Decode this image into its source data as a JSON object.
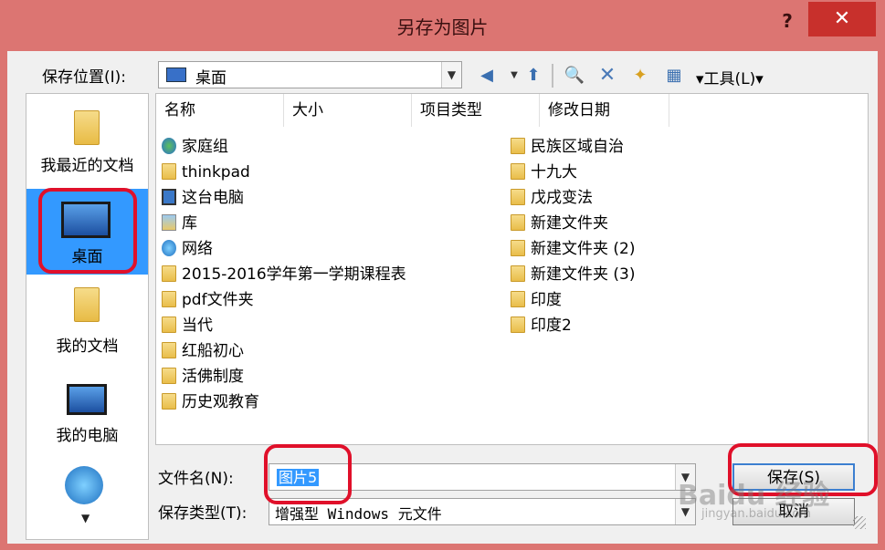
{
  "dialog": {
    "title": "另存为图片",
    "help_label": "?",
    "close_label": "✕"
  },
  "location": {
    "label": "保存位置(I):",
    "value": "桌面",
    "icon": "monitor-icon"
  },
  "toolbar": {
    "tools_label": "▾工具(L)▾"
  },
  "places": [
    {
      "label": "我最近的文档",
      "icon": "folder-icon"
    },
    {
      "label": "桌面",
      "icon": "monitor-icon",
      "selected": true
    },
    {
      "label": "我的文档",
      "icon": "folder-icon"
    },
    {
      "label": "我的电脑",
      "icon": "computer-icon"
    },
    {
      "label": "",
      "icon": "network-globe-icon"
    }
  ],
  "columns": [
    "名称",
    "大小",
    "项目类型",
    "修改日期"
  ],
  "files_left": [
    {
      "name": "家庭组",
      "icon": "homegroup-icon"
    },
    {
      "name": "thinkpad",
      "icon": "folder-icon"
    },
    {
      "name": "这台电脑",
      "icon": "computer-icon"
    },
    {
      "name": "库",
      "icon": "library-icon"
    },
    {
      "name": "网络",
      "icon": "network-icon"
    },
    {
      "name": "2015-2016学年第一学期课程表",
      "icon": "folder-icon"
    },
    {
      "name": "pdf文件夹",
      "icon": "folder-icon"
    },
    {
      "name": "当代",
      "icon": "folder-icon"
    },
    {
      "name": "红船初心",
      "icon": "folder-icon"
    },
    {
      "name": "活佛制度",
      "icon": "folder-icon"
    },
    {
      "name": "历史观教育",
      "icon": "folder-icon"
    }
  ],
  "files_right": [
    {
      "name": "民族区域自治",
      "icon": "folder-icon"
    },
    {
      "name": "十九大",
      "icon": "folder-icon"
    },
    {
      "name": "戊戌变法",
      "icon": "folder-icon"
    },
    {
      "name": "新建文件夹",
      "icon": "folder-icon"
    },
    {
      "name": "新建文件夹 (2)",
      "icon": "folder-icon"
    },
    {
      "name": "新建文件夹 (3)",
      "icon": "folder-icon"
    },
    {
      "name": "印度",
      "icon": "folder-icon"
    },
    {
      "name": "印度2",
      "icon": "folder-icon"
    }
  ],
  "filename": {
    "label": "文件名(N):",
    "value": "图片5"
  },
  "filetype": {
    "label": "保存类型(T):",
    "value": "增强型 Windows 元文件"
  },
  "buttons": {
    "save": "保存(S)",
    "cancel": "取消"
  },
  "watermark": {
    "main": "Baidu 经验",
    "sub": "jingyan.baidu.com"
  }
}
